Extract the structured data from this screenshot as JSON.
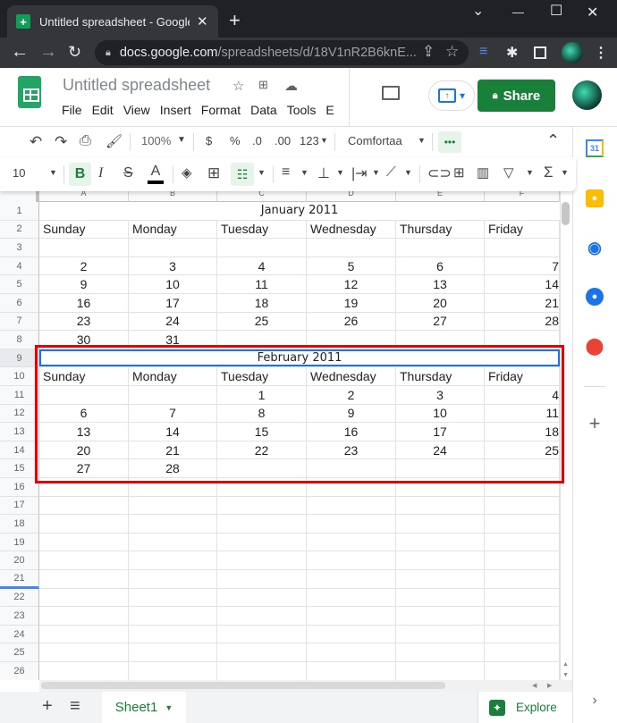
{
  "browser": {
    "tab_title": "Untitled spreadsheet - Google Sh",
    "url_host": "docs.google.com",
    "url_path": "/spreadsheets/d/18V1nR2B6knE...",
    "new_tab": "+",
    "close_tab": "✕",
    "minimize": "—",
    "maximize": "☐",
    "close": "✕",
    "tab_list": "⌄"
  },
  "header": {
    "doc_title": "Untitled spreadsheet",
    "menu": [
      "File",
      "Edit",
      "View",
      "Insert",
      "Format",
      "Data",
      "Tools",
      "E"
    ],
    "share_label": "Share"
  },
  "toolbar": {
    "zoom": "100%",
    "currency": "$",
    "percent": "%",
    "decrease_decimal": ".0",
    "increase_decimal": ".00",
    "number_format": "123",
    "font": "Comfortaa",
    "more": "•••",
    "font_size": "10",
    "bold": "B",
    "italic": "I",
    "strike": "S",
    "text_color": "A",
    "sum": "Σ"
  },
  "grid": {
    "columns": [
      "A",
      "B",
      "C",
      "D",
      "E",
      "F"
    ],
    "row_numbers": [
      "1",
      "2",
      "3",
      "4",
      "5",
      "6",
      "7",
      "8",
      "9",
      "10",
      "11",
      "12",
      "13",
      "14",
      "15",
      "16",
      "17",
      "18",
      "19",
      "20",
      "21",
      "22",
      "23",
      "24",
      "25",
      "26"
    ],
    "january_title": "January 2011",
    "february_title": "February 2011",
    "weekdays": [
      "Sunday",
      "Monday",
      "Tuesday",
      "Wednesday",
      "Thursday",
      "Friday"
    ],
    "january_weeks": [
      [
        "",
        "",
        "",
        "",
        "",
        ""
      ],
      [
        "2",
        "3",
        "4",
        "5",
        "6",
        "7"
      ],
      [
        "9",
        "10",
        "11",
        "12",
        "13",
        "14"
      ],
      [
        "16",
        "17",
        "18",
        "19",
        "20",
        "21"
      ],
      [
        "23",
        "24",
        "25",
        "26",
        "27",
        "28"
      ],
      [
        "30",
        "31",
        "",
        "",
        "",
        ""
      ]
    ],
    "february_weeks": [
      [
        "",
        "",
        "1",
        "2",
        "3",
        "4"
      ],
      [
        "6",
        "7",
        "8",
        "9",
        "10",
        "11"
      ],
      [
        "13",
        "14",
        "15",
        "16",
        "17",
        "18"
      ],
      [
        "20",
        "21",
        "22",
        "23",
        "24",
        "25"
      ],
      [
        "27",
        "28",
        "",
        "",
        "",
        ""
      ]
    ]
  },
  "bottom": {
    "add_sheet": "+",
    "all_sheets": "≡",
    "sheet_tab": "Sheet1",
    "explore_label": "Explore"
  },
  "colors": {
    "share_green": "#188038",
    "selection_blue": "#1a73e8",
    "highlight_red": "#e00000"
  }
}
